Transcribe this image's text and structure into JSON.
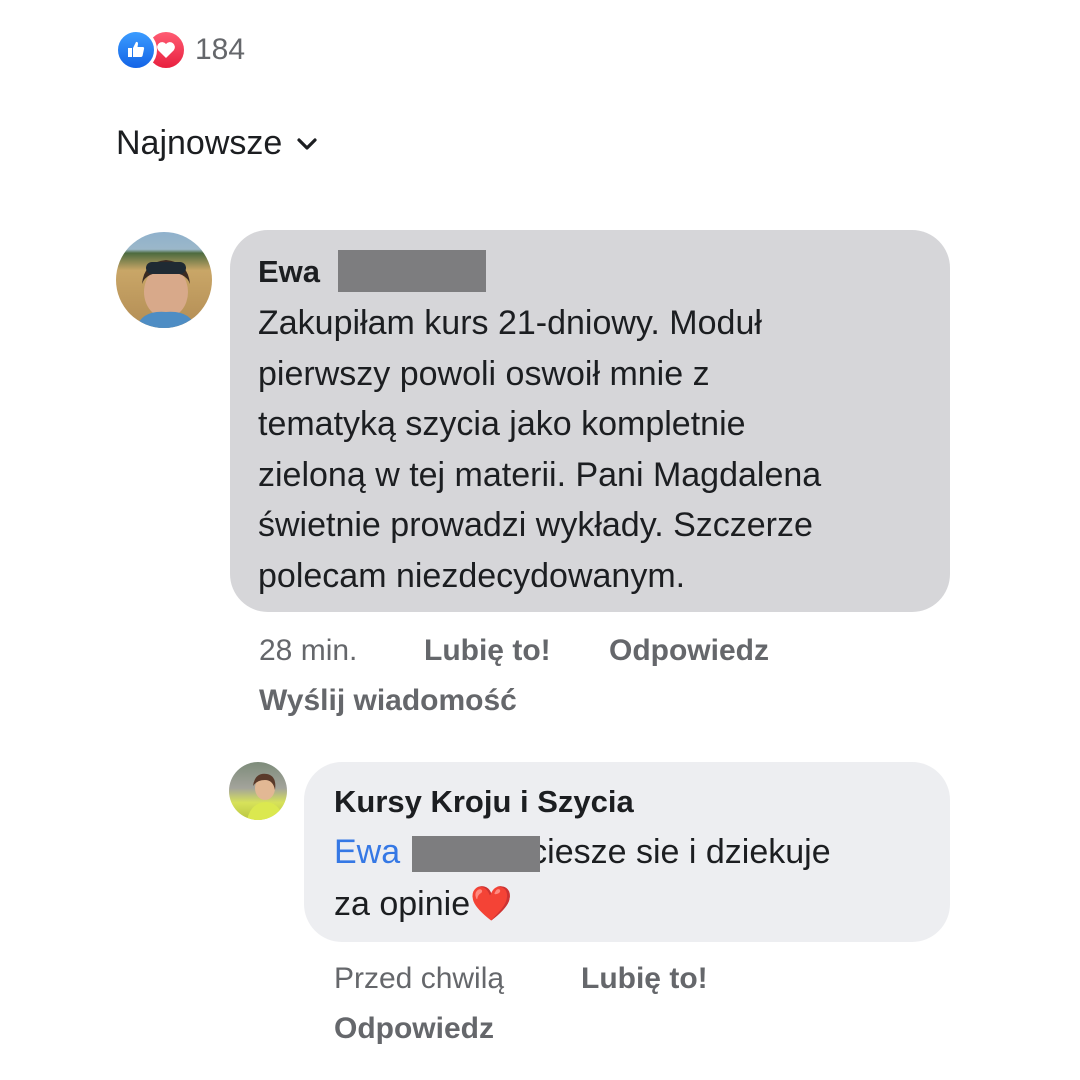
{
  "reactions": {
    "count": "184",
    "icons": [
      "like-icon",
      "love-icon"
    ],
    "like_color": "#1877f2",
    "love_color": "#f33e58"
  },
  "sort": {
    "label": "Najnowsze",
    "icon": "chevron-down-icon"
  },
  "comment": {
    "author": "Ewa",
    "text": "Zakupiłam kurs 21-dniowy. Moduł\npierwszy powoli oswoił mnie z\ntematyką szycia jako kompletnie\nzieloną w tej materii. Pani Magdalena\nświetnie prowadzi wykłady. Szczerze\npolecam niezdecydowanym.",
    "time": "28 min.",
    "like_label": "Lubię to!",
    "reply_label": "Odpowiedz",
    "message_label": "Wyślij wiadomość"
  },
  "reply": {
    "author": "Kursy Kroju i Szycia",
    "mention": "Ewa",
    "text_line1": "ciesze sie i dziekuje",
    "text_line2": "za opinie",
    "emoji": "❤️",
    "time": "Przed chwilą",
    "like_label": "Lubię to!",
    "reply_label": "Odpowiedz"
  }
}
